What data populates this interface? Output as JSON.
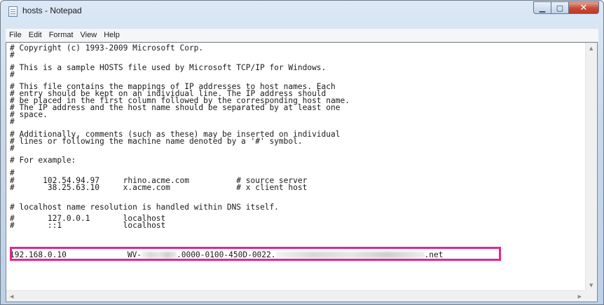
{
  "window": {
    "title": "hosts - Notepad",
    "app_icon": "notepad-icon"
  },
  "caption_buttons": {
    "minimize": "minimize-icon",
    "maximize": "maximize-icon",
    "close": "close-icon"
  },
  "menu": [
    "File",
    "Edit",
    "Format",
    "View",
    "Help"
  ],
  "lines": [
    "# Copyright (c) 1993-2009 Microsoft Corp.",
    "#",
    "# This is a sample HOSTS file used by Microsoft TCP/IP for Windows.",
    "#",
    "# This file contains the mappings of IP addresses to host names. Each",
    "# entry should be kept on an individual line. The IP address should",
    "# be placed in the first column followed by the corresponding host name.",
    "# The IP address and the host name should be separated by at least one",
    "# space.",
    "#",
    "# Additionally, comments (such as these) may be inserted on individual",
    "# lines or following the machine name denoted by a '#' symbol.",
    "#",
    "# For example:",
    "#",
    "#      102.54.94.97     rhino.acme.com          # source server",
    "#       38.25.63.10     x.acme.com              # x client host",
    "",
    "# localhost name resolution is handled within DNS itself.",
    "#\t127.0.0.1       localhost",
    "#\t::1             localhost"
  ],
  "entry": {
    "ip": "192.168.0.10",
    "host_prefix": "WV-",
    "host_middle": ".0000-0100-450D-0022.",
    "host_suffix": ".net"
  },
  "colors": {
    "highlight_border": "#e3268f",
    "close_button": "#c74a34"
  }
}
